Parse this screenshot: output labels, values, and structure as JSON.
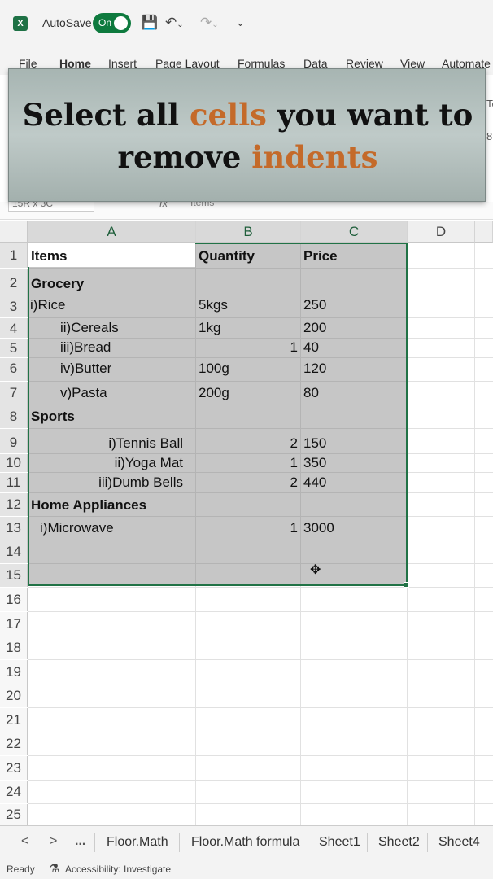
{
  "titlebar": {
    "app_logo": "X",
    "autosave_label": "AutoSave",
    "toggle_text": "On",
    "icons": [
      "save-icon",
      "undo-icon",
      "redo-icon",
      "customize-qat-icon"
    ]
  },
  "ribbon": {
    "tabs": [
      "File",
      "Home",
      "Insert",
      "Page Layout",
      "Formulas",
      "Data",
      "Review",
      "View",
      "Automate"
    ],
    "active_tab": "Home"
  },
  "banner": {
    "line1_part1": "Select all ",
    "line1_accent": "cells",
    "line1_part2": " you want to",
    "line2_part1": "remove ",
    "line2_accent": "indents",
    "accent_color": "#c46a2a",
    "edge_fragments": [
      "Te",
      "8"
    ]
  },
  "formula_bar": {
    "name_box": "15R x 3C",
    "fx": "fx",
    "content": "Items"
  },
  "grid": {
    "columns": [
      "A",
      "B",
      "C",
      "D"
    ],
    "rows": [
      "1",
      "2",
      "3",
      "4",
      "5",
      "6",
      "7",
      "8",
      "9",
      "10",
      "11",
      "12",
      "13",
      "14",
      "15",
      "16",
      "17",
      "18",
      "19",
      "20",
      "21",
      "22",
      "23",
      "24",
      "25"
    ],
    "cells": {
      "A1": "Items",
      "B1": "Quantity",
      "C1": "Price",
      "A2": "Grocery",
      "A3": "i)Rice",
      "B3": "5kgs",
      "C3": "250",
      "A4": "ii)Cereals",
      "B4": "1kg",
      "C4": "200",
      "A5": "iii)Bread",
      "B5": "1",
      "C5": "40",
      "A6": "iv)Butter",
      "B6": "100g",
      "C6": "120",
      "A7": "v)Pasta",
      "B7": "200g",
      "C7": "80",
      "A8": "Sports",
      "A9": "i)Tennis Ball",
      "B9": "2",
      "C9": "150",
      "A10": "ii)Yoga Mat",
      "B10": "1",
      "C10": "350",
      "A11": "iii)Dumb Bells",
      "B11": "2",
      "C11": "440",
      "A12": "Home Appliances",
      "A13": "i)Microwave",
      "B13": "1",
      "C13": "3000"
    },
    "selection_color": "#217346"
  },
  "sheet_tabs": {
    "nav": [
      "<",
      ">",
      "..."
    ],
    "tabs": [
      "Floor.Math",
      "Floor.Math formula",
      "Sheet1",
      "Sheet2",
      "Sheet4"
    ]
  },
  "status": {
    "ready": "Ready",
    "accessibility": "Accessibility: Investigate"
  }
}
